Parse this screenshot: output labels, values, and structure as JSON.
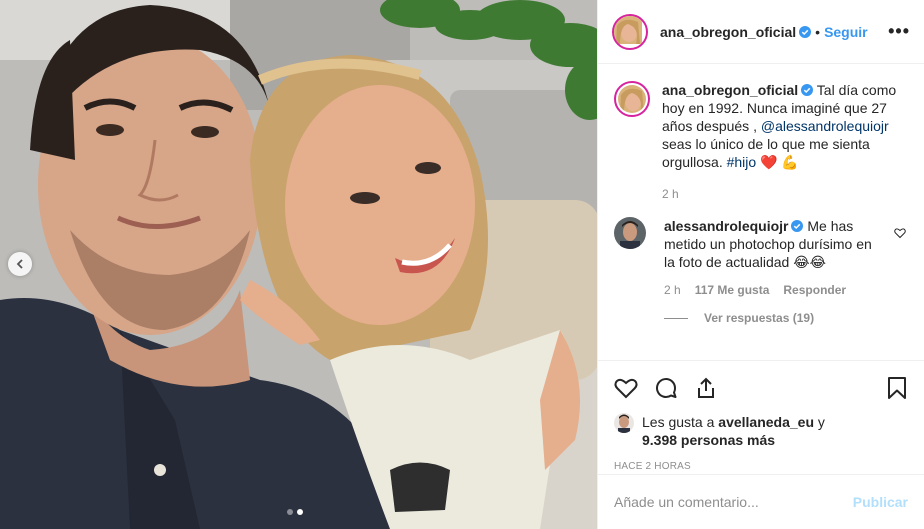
{
  "post": {
    "author": "ana_obregon_oficial",
    "follow_label": "Seguir",
    "bullet": "•",
    "more_label": "•••",
    "caption_prefix": "Tal día como hoy en 1992. Nunca imaginé que 27 años después ,",
    "caption_mention": "@alessandrolequiojr",
    "caption_middle": "seas lo único de lo que me sienta orgullosa.",
    "caption_hashtag": "#hijo",
    "caption_emoji": "❤️ 💪",
    "caption_time": "2 h"
  },
  "comment": {
    "author": "alessandrolequiojr",
    "text": "Me has metido un photochop durísimo en la foto de actualidad",
    "emoji": "😂😂",
    "time": "2 h",
    "likes": "117 Me gusta",
    "reply_label": "Responder",
    "view_replies": "Ver respuestas (19)"
  },
  "likes": {
    "prefix": "Les gusta a",
    "user": "avellaneda_eu",
    "suffix": "y",
    "others": "9.398 personas más"
  },
  "timestamp": "HACE 2 HORAS",
  "add_comment": {
    "placeholder": "Añade un comentario...",
    "publish_label": "Publicar"
  },
  "carousel": {
    "count": 2,
    "active": 2
  },
  "icons": {
    "like": "heart-icon",
    "comment": "comment-icon",
    "share": "share-icon",
    "save": "bookmark-icon",
    "verified": "verified-badge-icon",
    "prev": "chevron-left-icon"
  },
  "colors": {
    "link": "#3897f0",
    "publish_disabled": "#b2dffc",
    "muted": "#8e8e8e",
    "text": "#262626"
  }
}
